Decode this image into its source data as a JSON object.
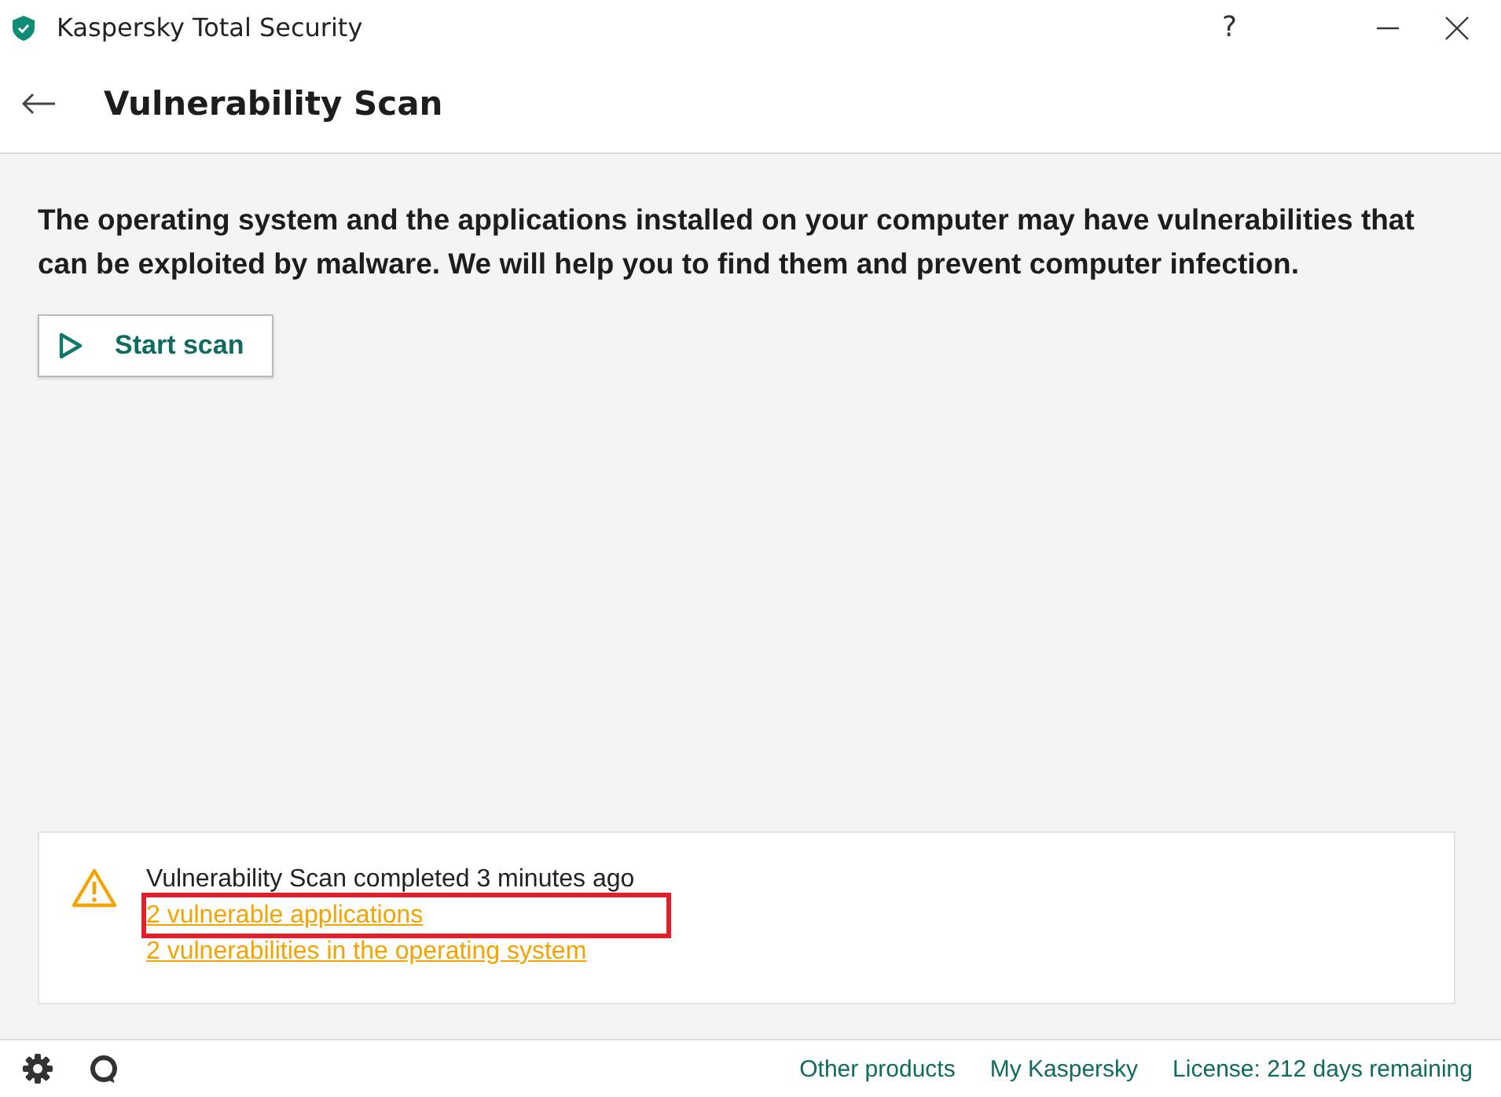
{
  "window": {
    "title": "Kaspersky Total Security",
    "help": "?"
  },
  "header": {
    "title": "Vulnerability Scan"
  },
  "description": "The operating system and the applications installed on your computer may have vulnerabilities that can be exploited by malware. We will help you to find them and prevent computer infection.",
  "start_button": {
    "label": "Start scan"
  },
  "result": {
    "status": "Vulnerability Scan completed 3 minutes ago",
    "links": [
      {
        "label": "2 vulnerable applications",
        "highlighted": true
      },
      {
        "label": "2 vulnerabilities in the operating system",
        "highlighted": false
      }
    ]
  },
  "footer": {
    "links": [
      "Other products",
      "My Kaspersky",
      "License: 212 days remaining"
    ]
  }
}
